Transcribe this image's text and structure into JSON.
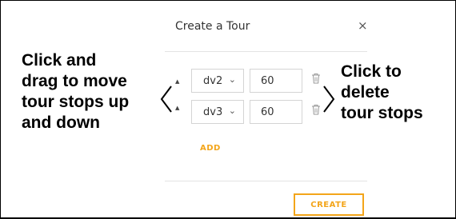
{
  "dialog": {
    "title": "Create a Tour",
    "close_glyph": "×",
    "add_label": "ADD",
    "create_label": "CREATE"
  },
  "tour_stops": [
    {
      "stop": "dv2",
      "duration": "60"
    },
    {
      "stop": "dv3",
      "duration": "60"
    }
  ],
  "annotations": {
    "left_lines": [
      "Click and",
      "drag to move",
      "tour stops up",
      "and down"
    ],
    "right_lines": [
      "Click to",
      "delete",
      "tour stops"
    ]
  },
  "icons": {
    "drag": "drag-handle-icon",
    "dropdown": "chevron-down-icon",
    "delete": "trash-icon",
    "close": "close-icon"
  },
  "colors": {
    "accent": "#f3a51a",
    "border": "#d4d4d4",
    "text": "#333333"
  }
}
